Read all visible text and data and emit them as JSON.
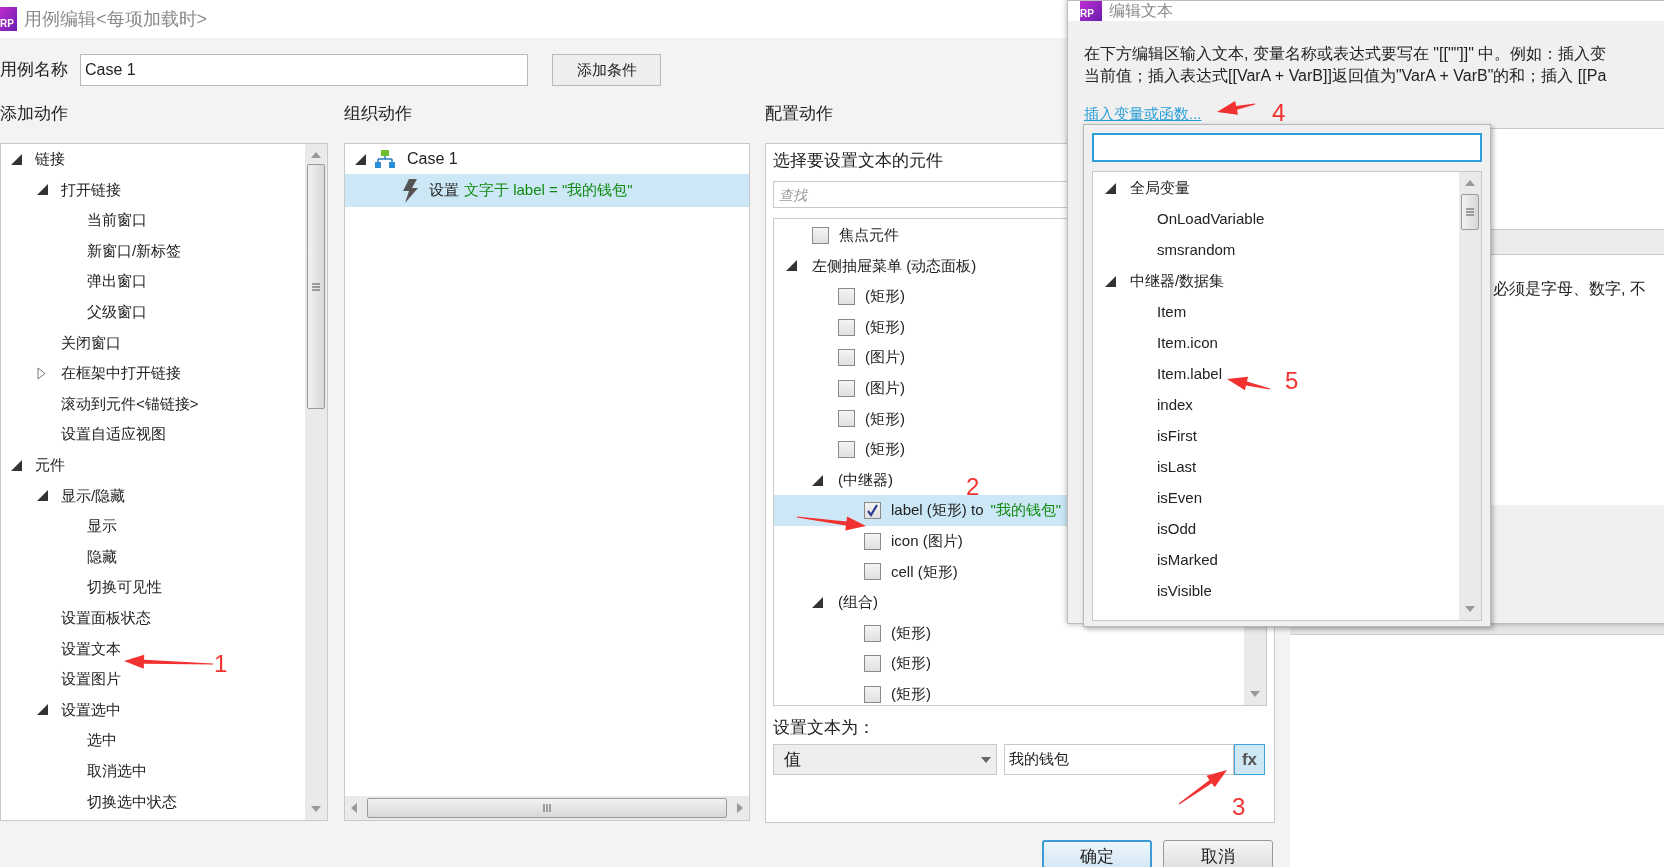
{
  "main_window": {
    "logo": "RP",
    "title": "用例编辑<每项加载时>"
  },
  "case_name": {
    "label": "用例名称",
    "value": "Case 1"
  },
  "add_condition_button": "添加条件",
  "add_actions": {
    "heading": "添加动作",
    "tree": [
      {
        "label": "链接",
        "expanded": true,
        "children": [
          {
            "label": "打开链接",
            "expanded": true,
            "children": [
              {
                "label": "当前窗口"
              },
              {
                "label": "新窗口/新标签"
              },
              {
                "label": "弹出窗口"
              },
              {
                "label": "父级窗口"
              }
            ]
          },
          {
            "label": "关闭窗口"
          },
          {
            "label": "在框架中打开链接",
            "expanded": false
          },
          {
            "label": "滚动到元件<锚链接>"
          },
          {
            "label": "设置自适应视图"
          }
        ]
      },
      {
        "label": "元件",
        "expanded": true,
        "children": [
          {
            "label": "显示/隐藏",
            "expanded": true,
            "children": [
              {
                "label": "显示"
              },
              {
                "label": "隐藏"
              },
              {
                "label": "切换可见性"
              }
            ]
          },
          {
            "label": "设置面板状态"
          },
          {
            "label": "设置文本"
          },
          {
            "label": "设置图片"
          },
          {
            "label": "设置选中",
            "expanded": true,
            "children": [
              {
                "label": "选中"
              },
              {
                "label": "取消选中"
              },
              {
                "label": "切换选中状态"
              }
            ]
          }
        ]
      }
    ]
  },
  "organize_actions": {
    "heading": "组织动作",
    "tree": [
      {
        "label": "Case 1",
        "expanded": true,
        "children": [
          {
            "verb": "设置",
            "detail": "文字于 label = \"我的钱包\"",
            "selected": true
          }
        ]
      }
    ]
  },
  "configure_action": {
    "heading": "配置动作",
    "widget_heading": "选择要设置文本的元件",
    "search": {
      "placeholder": "查找"
    },
    "tree": [
      {
        "label": "焦点元件",
        "checked": false,
        "selected": false
      },
      {
        "label": "左侧抽屉菜单 (动态面板)",
        "expanded": true,
        "children": [
          {
            "label": "(矩形)",
            "checked": false,
            "selected": false
          },
          {
            "label": "(矩形)",
            "checked": false,
            "selected": false
          },
          {
            "label": "(图片)",
            "checked": false,
            "selected": false
          },
          {
            "label": "(图片)",
            "checked": false,
            "selected": false
          },
          {
            "label": "(矩形)",
            "checked": false,
            "selected": false
          },
          {
            "label": "(矩形)",
            "checked": false,
            "selected": false
          },
          {
            "label": "(中继器)",
            "expanded": true,
            "children": [
              {
                "label": "label (矩形) to",
                "value": "\"我的钱包\"",
                "checked": true,
                "selected": true
              },
              {
                "label": "icon (图片)",
                "checked": false,
                "selected": false
              },
              {
                "label": "cell (矩形)",
                "checked": false,
                "selected": false
              }
            ]
          },
          {
            "label": "(组合)",
            "expanded": true,
            "children": [
              {
                "label": "(矩形)",
                "checked": false,
                "selected": false
              },
              {
                "label": "(矩形)",
                "checked": false,
                "selected": false
              },
              {
                "label": "(矩形)",
                "checked": false,
                "selected": false
              }
            ]
          }
        ]
      }
    ],
    "set_text_label": "设置文本为：",
    "value_type": "值",
    "value": "我的钱包",
    "fx_button": "fx"
  },
  "buttons": [
    {
      "label": "确定",
      "default": true
    },
    {
      "label": "取消",
      "default": false
    }
  ],
  "edit_text_window": {
    "logo": "RP",
    "title": "编辑文本",
    "instructions": [
      "在下方编辑区输入文本, 变量名称或表达式要写在 \"[[\"\"]]\" 中。例如：插入变",
      "当前值；插入表达式[[VarA + VarB]]返回值为\"VarA + VarB\"的和；插入 [[Pa"
    ],
    "insert_link": "插入变量或函数...",
    "partial_text": "必须是字母、数字, 不"
  },
  "variable_popup": {
    "tree": [
      {
        "label": "全局变量",
        "expanded": true,
        "children": [
          {
            "label": "OnLoadVariable"
          },
          {
            "label": "smsrandom"
          }
        ]
      },
      {
        "label": "中继器/数据集",
        "expanded": true,
        "children": [
          {
            "label": "Item"
          },
          {
            "label": "Item.icon"
          },
          {
            "label": "Item.label"
          },
          {
            "label": "index"
          },
          {
            "label": "isFirst"
          },
          {
            "label": "isLast"
          },
          {
            "label": "isEven"
          },
          {
            "label": "isOdd"
          },
          {
            "label": "isMarked"
          },
          {
            "label": "isVisible"
          }
        ]
      }
    ]
  },
  "annotations": [
    "1",
    "2",
    "3",
    "4",
    "5"
  ]
}
